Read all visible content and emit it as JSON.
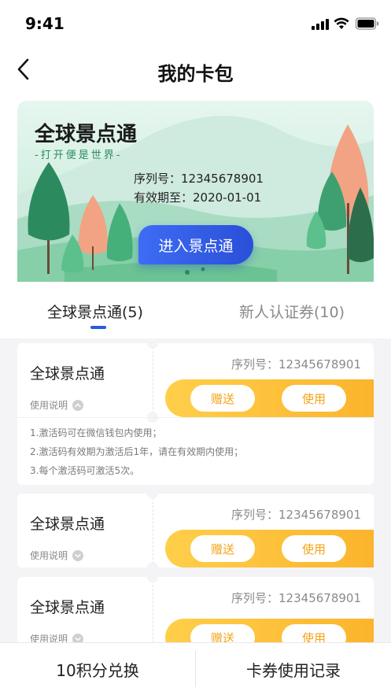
{
  "status_bar": {
    "time": "9:41",
    "icons": [
      "signal-icon",
      "wifi-icon",
      "battery-icon"
    ]
  },
  "nav": {
    "title": "我的卡包",
    "back_icon": "chevron-left-icon"
  },
  "hero": {
    "title": "全球景点通",
    "slogan": "-打开便是世界-",
    "serial": "序列号：12345678901",
    "expiry": "有效期至：2020-01-01",
    "button_label": "进入景点通"
  },
  "tabs": [
    {
      "label": "全球景点通(5)",
      "active": true
    },
    {
      "label": "新人认证券(10)",
      "active": false
    }
  ],
  "tickets": [
    {
      "name": "全球景点通",
      "help_label": "使用说明",
      "serial": "序列号：12345678901",
      "gift_label": "赠送",
      "use_label": "使用",
      "expanded": true,
      "rules": [
        "1.激活码可在微信钱包内使用；",
        "2.激活码有效期为激活后1年，请在有效期内使用；",
        "3.每个激活码可激活5次。"
      ]
    },
    {
      "name": "全球景点通",
      "help_label": "使用说明",
      "serial": "序列号：12345678901",
      "gift_label": "赠送",
      "use_label": "使用",
      "expanded": false
    },
    {
      "name": "全球景点通",
      "help_label": "使用说明",
      "serial": "序列号：12345678901",
      "gift_label": "赠送",
      "use_label": "使用",
      "expanded": false
    }
  ],
  "bottom": {
    "left_label": "10积分兑换",
    "right_label": "卡券使用记录"
  },
  "colors": {
    "accent_blue": "#2a5ae0",
    "action_orange": "#fbb42c",
    "brand_green": "#2c8a5f"
  }
}
